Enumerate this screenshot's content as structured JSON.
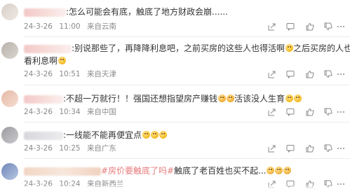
{
  "comments": [
    {
      "name": "",
      "text_before": ":怎么可能会有底，触底了地方财政会崩......",
      "topic": "",
      "text_after": "",
      "emojis_after": [],
      "line2": "",
      "date": "24-3-26",
      "time": "11:00",
      "location": "来自云南"
    },
    {
      "name": "",
      "text_before": ":别说那些了，再降降利息吧，之前买房的这些人也得活啊",
      "topic": "",
      "text_after": "之后买房的人也得",
      "line2": "看利息啊",
      "date": "24-3-26",
      "time": "10:51",
      "location": "来自天津"
    },
    {
      "name": "",
      "text_before": ":不超一万就行！！强国还想指望房产赚钱",
      "topic": "",
      "text_after": "活该没人生育",
      "line2": "",
      "date": "24-3-26",
      "time": "10:34",
      "location": "来自中国"
    },
    {
      "name": "",
      "text_before": ":一线能不能再便宜点",
      "topic": "",
      "text_after": "",
      "line2": "",
      "date": "24-3-26",
      "time": "10:25",
      "location": "来自广东"
    },
    {
      "name": "",
      "text_before": "",
      "topic": "#房价要触底了吗#",
      "text_after": "触底了老百姓也买不起...",
      "line2": "",
      "date": "24-3-26",
      "time": "10:24",
      "location": "来自新西兰"
    }
  ],
  "icons": {
    "share": "share-icon",
    "reply": "comment-icon",
    "like": "thumbs-up-icon",
    "dislike": "thumbs-down-icon",
    "more": "more-icon"
  },
  "colors": {
    "topic": "#e87a7a",
    "meta": "#8a8a8a",
    "divider": "#ececec"
  }
}
